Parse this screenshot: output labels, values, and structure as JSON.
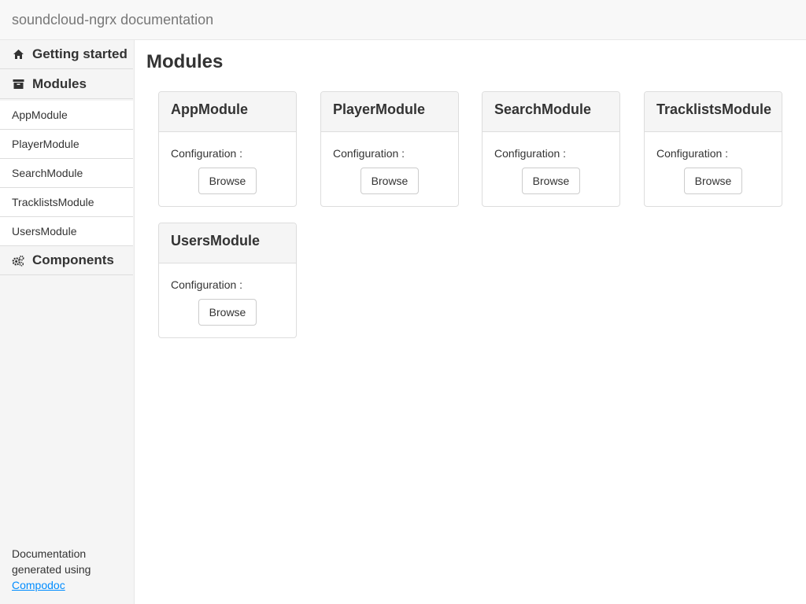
{
  "header": {
    "title": "soundcloud-ngrx documentation"
  },
  "sidebar": {
    "getting_started": {
      "label": "Getting started",
      "icon": "home-icon"
    },
    "modules": {
      "label": "Modules",
      "icon": "archive-icon",
      "items": [
        {
          "label": "AppModule"
        },
        {
          "label": "PlayerModule"
        },
        {
          "label": "SearchModule"
        },
        {
          "label": "TracklistsModule"
        },
        {
          "label": "UsersModule"
        }
      ]
    },
    "components": {
      "label": "Components",
      "icon": "cogs-icon"
    },
    "footer": {
      "text_line1": "Documentation",
      "text_line2": "generated using",
      "link": "Compodoc"
    }
  },
  "main": {
    "title": "Modules",
    "cards": [
      {
        "name": "AppModule",
        "config_label": "Configuration :",
        "button_label": "Browse"
      },
      {
        "name": "PlayerModule",
        "config_label": "Configuration :",
        "button_label": "Browse"
      },
      {
        "name": "SearchModule",
        "config_label": "Configuration :",
        "button_label": "Browse"
      },
      {
        "name": "TracklistsModule",
        "config_label": "Configuration :",
        "button_label": "Browse"
      },
      {
        "name": "UsersModule",
        "config_label": "Configuration :",
        "button_label": "Browse"
      }
    ]
  },
  "colors": {
    "link": "#008cff",
    "sidebar_bg": "#f5f5f5",
    "border": "#dddddd",
    "brand_text": "#777777"
  }
}
